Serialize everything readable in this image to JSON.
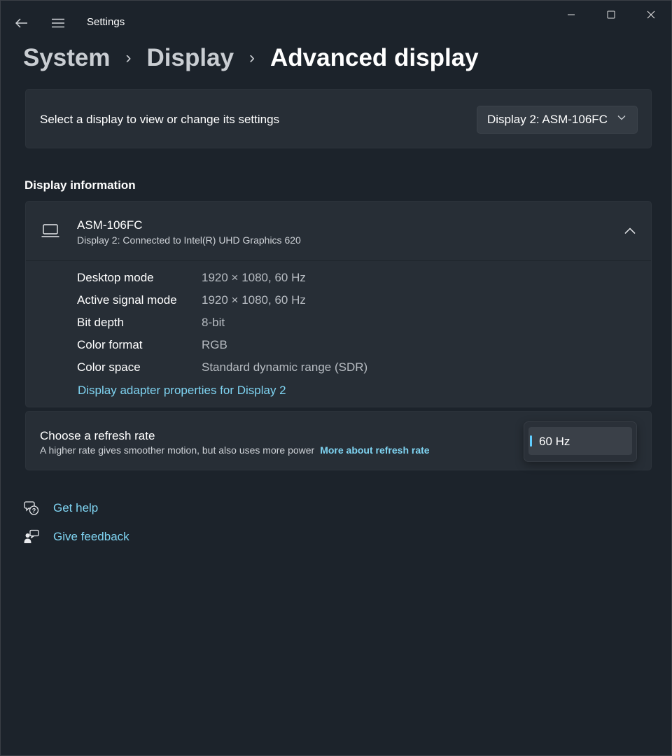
{
  "window": {
    "title": "Settings"
  },
  "breadcrumb": {
    "items": [
      "System",
      "Display"
    ],
    "current": "Advanced display"
  },
  "display_select": {
    "label": "Select a display to view or change its settings",
    "selected": "Display 2: ASM-106FC"
  },
  "display_information": {
    "header": "Display information",
    "monitor_name": "ASM-106FC",
    "connection": "Display 2: Connected to Intel(R) UHD Graphics 620",
    "rows": [
      {
        "key": "Desktop mode",
        "value": "1920 × 1080, 60 Hz"
      },
      {
        "key": "Active signal mode",
        "value": "1920 × 1080, 60 Hz"
      },
      {
        "key": "Bit depth",
        "value": "8-bit"
      },
      {
        "key": "Color format",
        "value": "RGB"
      },
      {
        "key": "Color space",
        "value": "Standard dynamic range (SDR)"
      }
    ],
    "adapter_link": "Display adapter properties for Display 2"
  },
  "refresh_rate": {
    "title": "Choose a refresh rate",
    "description": "A higher rate gives smoother motion, but also uses more power",
    "link": "More about refresh rate",
    "selected": "60 Hz"
  },
  "help": {
    "get_help": "Get help",
    "give_feedback": "Give feedback"
  },
  "colors": {
    "background": "#1c232b",
    "card": "#272e36",
    "accent": "#60cdff",
    "link": "#7fd4f2"
  },
  "icons": {
    "back": "back-arrow-icon",
    "menu": "hamburger-menu-icon",
    "minimize": "minimize-icon",
    "maximize": "maximize-icon",
    "close": "close-icon",
    "dropdown": "chevron-down-icon",
    "collapse": "chevron-up-icon",
    "monitor": "laptop-icon",
    "help": "help-chat-icon",
    "feedback": "feedback-icon"
  }
}
